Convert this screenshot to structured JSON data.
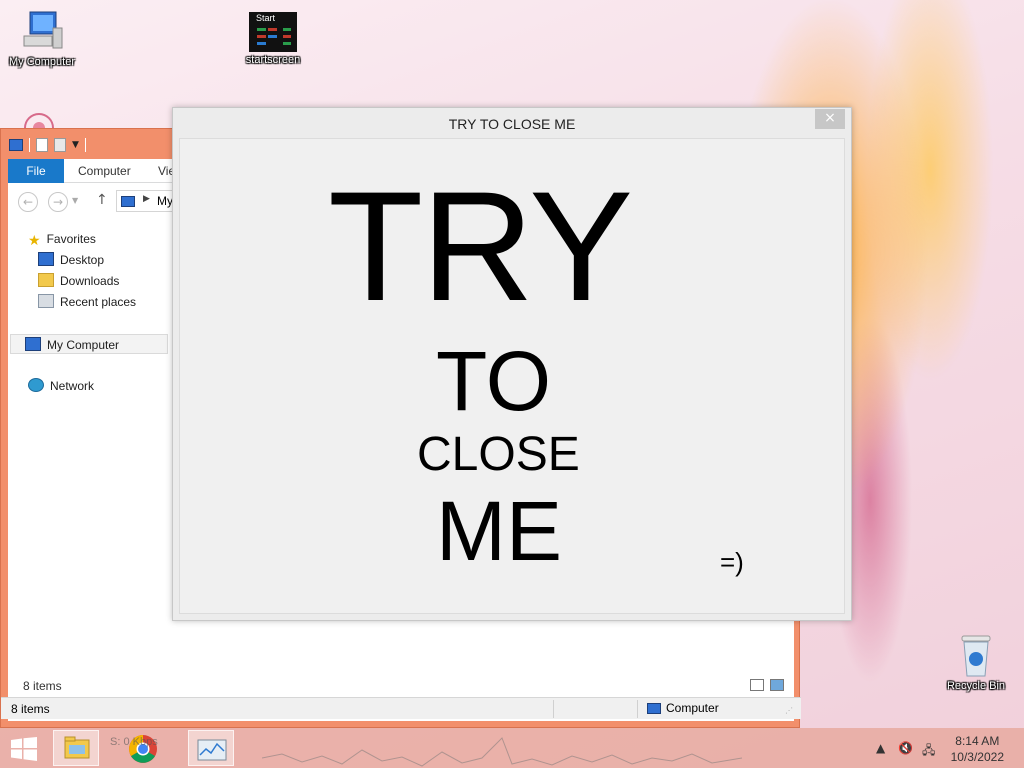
{
  "desktop": {
    "icons": [
      {
        "label": "My Computer",
        "icon": "computer-icon"
      },
      {
        "label": "startscreen",
        "icon": "startscreen-icon",
        "thumb_text": "Start"
      },
      {
        "label": "Recycle Bin",
        "icon": "recycle-bin-icon"
      }
    ]
  },
  "explorer": {
    "tabs": {
      "file": "File",
      "computer": "Computer",
      "view": "Vie"
    },
    "address": "My",
    "nav": {
      "favorites": "Favorites",
      "desktop": "Desktop",
      "downloads": "Downloads",
      "recent": "Recent places",
      "my_computer": "My Computer",
      "network": "Network"
    },
    "items_count_inner": "8 items",
    "status": {
      "items": "8 items",
      "location": "Computer"
    }
  },
  "popup": {
    "title": "TRY TO CLOSE ME",
    "close_glyph": "×",
    "words": [
      "TRY",
      "TO",
      "CLOSE",
      "ME"
    ],
    "smiley": "=)"
  },
  "taskbar": {
    "time": "8:14 AM",
    "date": "10/3/2022",
    "background_text": "S: 0 Kbps"
  },
  "colors": {
    "explorer_frame": "#f28f6b",
    "file_tab": "#1979ca",
    "popup_bg": "#f0f0f0"
  }
}
